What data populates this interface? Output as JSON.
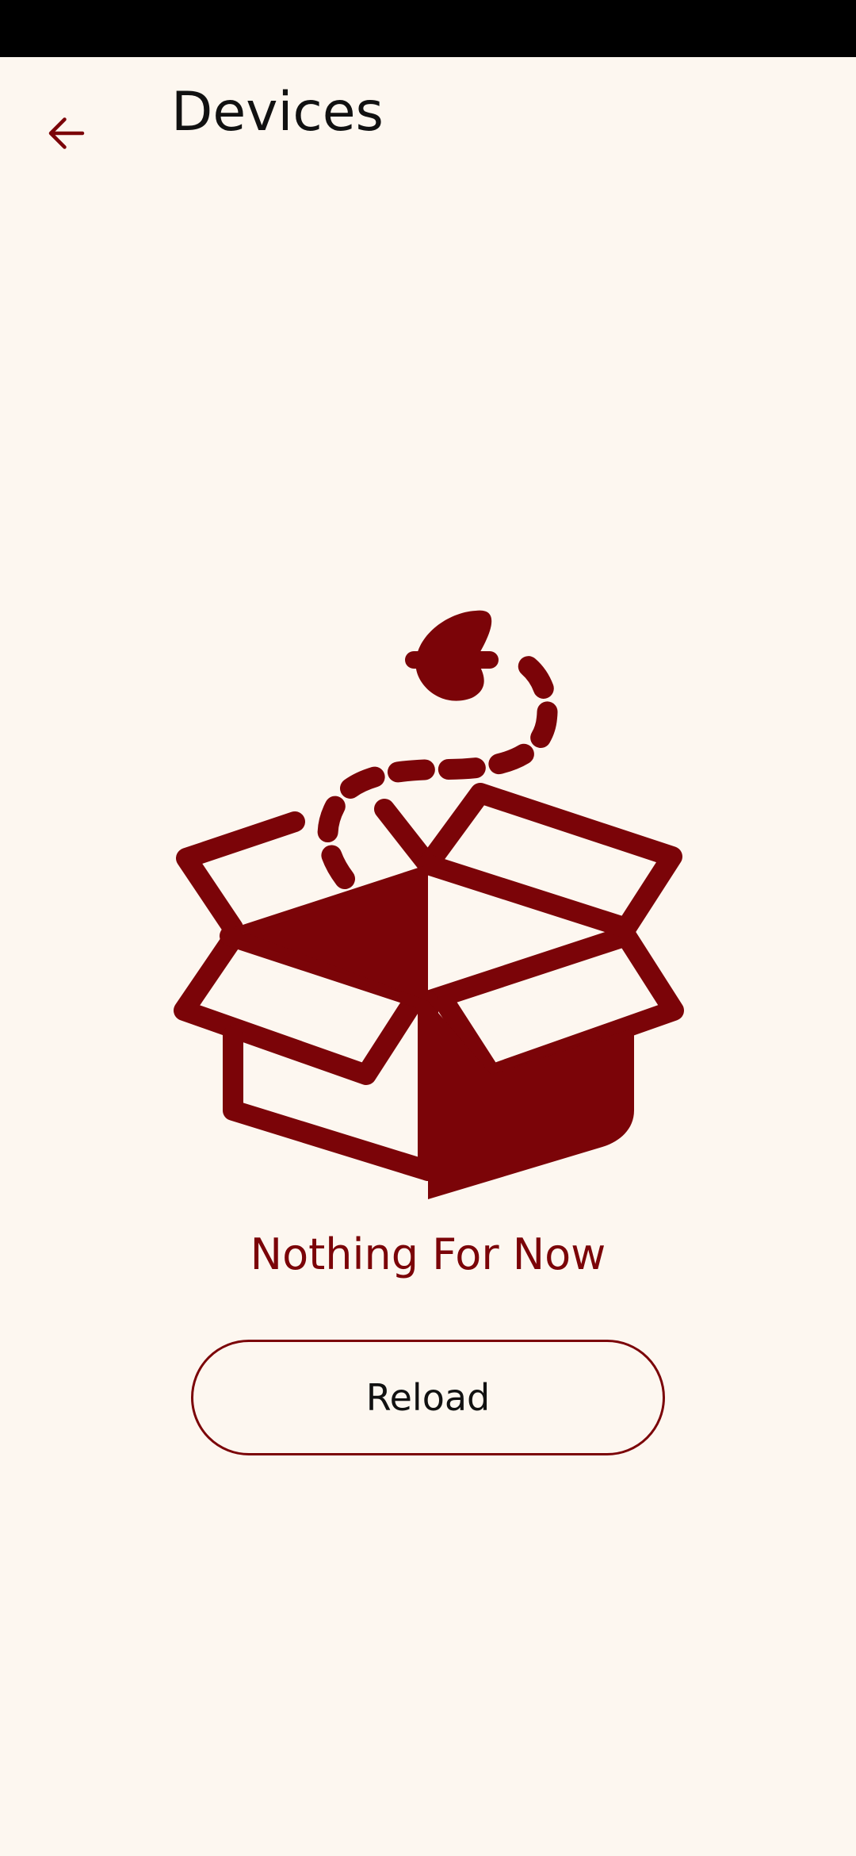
{
  "header": {
    "back_icon": "arrow-left-icon",
    "title": "Devices"
  },
  "empty_state": {
    "illustration_icon": "open-box-icon",
    "message": "Nothing For Now",
    "reload_label": "Reload"
  },
  "colors": {
    "background": "#fdf7f0",
    "accent": "#7b0408",
    "text": "#111111",
    "status_bar": "#000000"
  }
}
